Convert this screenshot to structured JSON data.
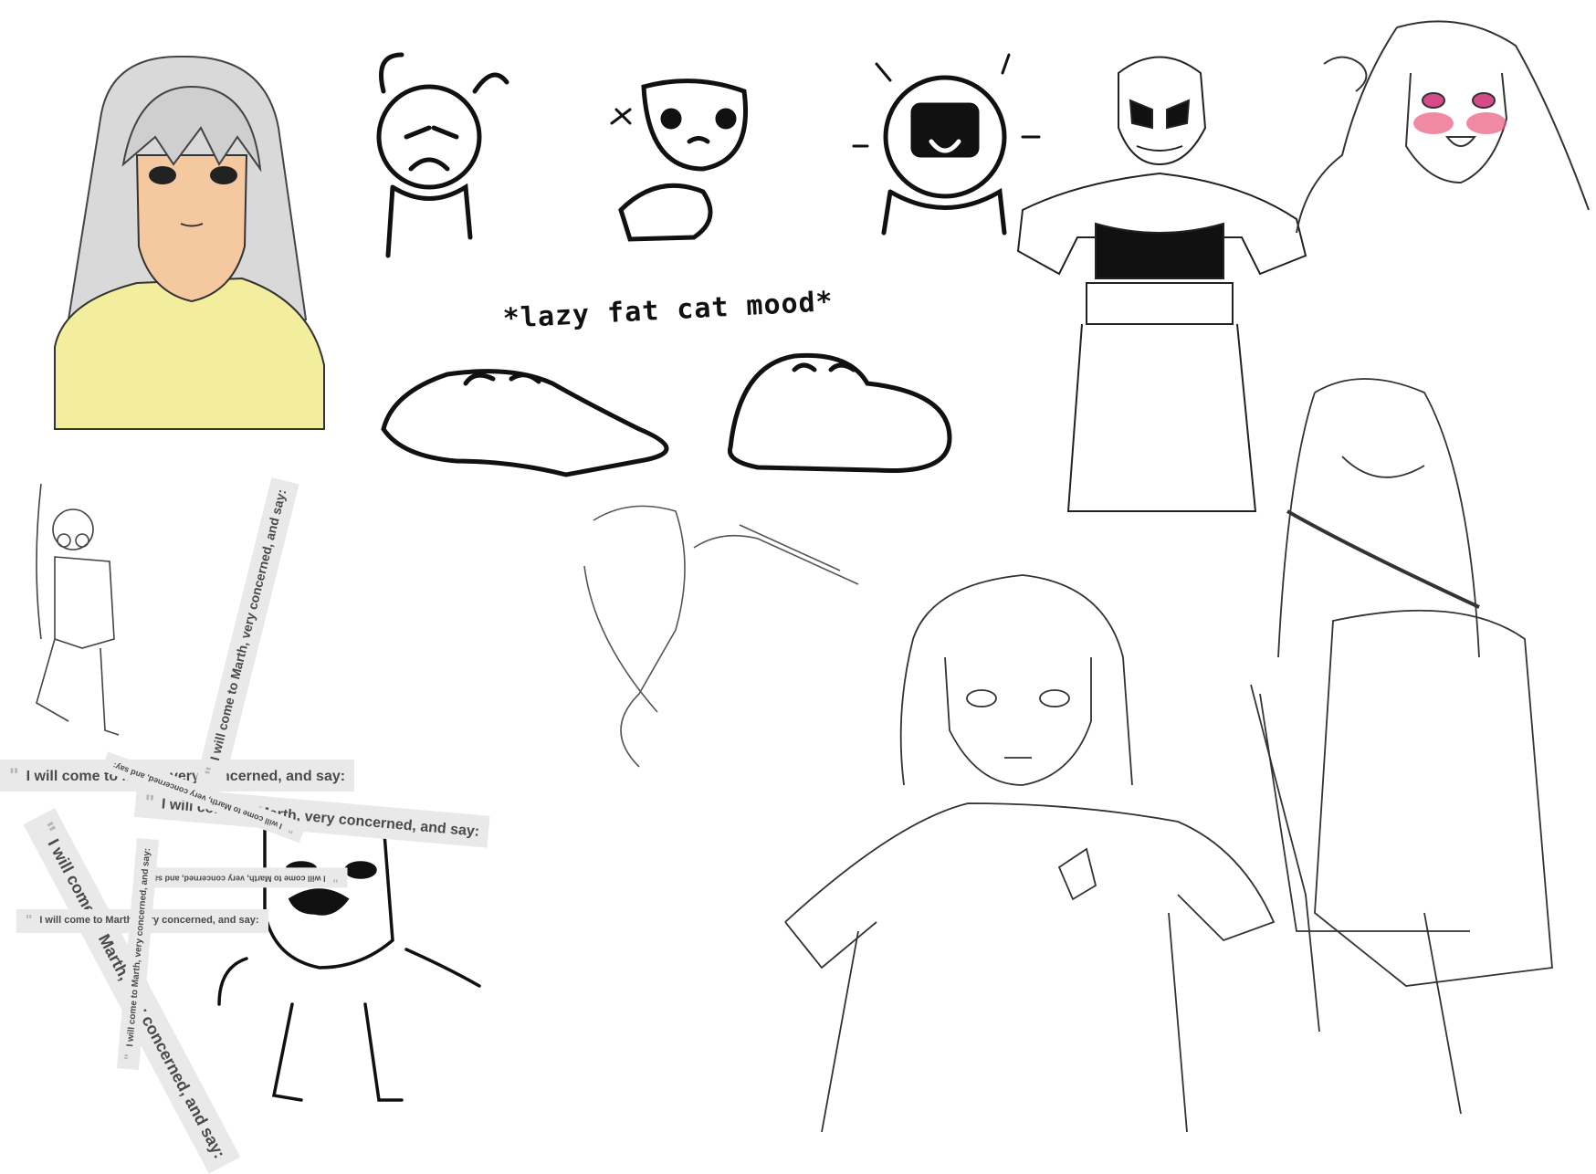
{
  "cat_caption": "*lazy fat cat mood*",
  "quote_strips": [
    "I will come to Marth, very concerned, and say:",
    "I will come to Marth, very concerned, and say:",
    "I will come to Marth, very concerned, and say:",
    "I will come to Marth, very concerned, and say:",
    "I will come to Marth, very concerned, and say:",
    "I will come to Marth, very concerned, and say:",
    "I will come to Marth, very concerned, and say:",
    "I will come to Marth, very concerned, and say:"
  ],
  "colors": {
    "hair": "#d9d9d9",
    "skin": "#f5c9a0",
    "shirt": "#f3ee9e",
    "blush": "#e8587a",
    "ink": "#111111",
    "sketch": "#333333",
    "strip_bg": "#e9e9e9"
  }
}
